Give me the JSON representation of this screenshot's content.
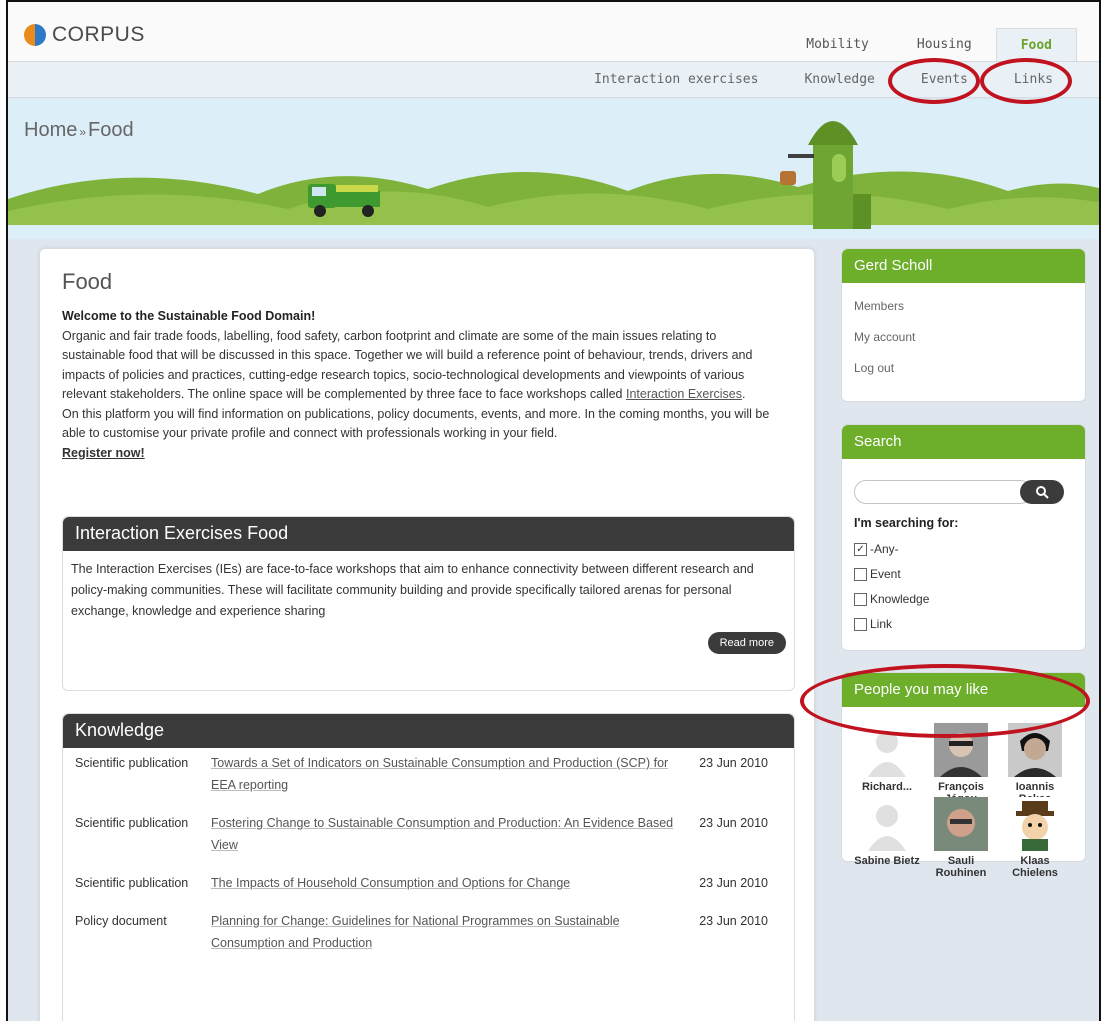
{
  "brand": {
    "name": "CORPUS"
  },
  "main_tabs": [
    {
      "label": "Mobility",
      "active": false
    },
    {
      "label": "Housing",
      "active": false
    },
    {
      "label": "Food",
      "active": true
    }
  ],
  "sub_tabs": [
    {
      "label": "Interaction exercises"
    },
    {
      "label": "Knowledge"
    },
    {
      "label": "Events"
    },
    {
      "label": "Links"
    }
  ],
  "breadcrumb": {
    "home": "Home",
    "sep": "»",
    "current": "Food"
  },
  "page": {
    "title": "Food",
    "welcome": "Welcome to the Sustainable Food Domain!",
    "para1": "Organic and fair trade foods, labelling, food safety, carbon footprint and climate  are some of the main issues relating to sustainable food that will be discussed in this space. Together we will build a reference point of behaviour, trends, drivers and impacts of policies and practices, cutting-edge research topics, socio-technological developments and viewpoints of various relevant stakeholders. The online space will be complemented by three face to face workshops called ",
    "para1_link": "Interaction Exercises",
    "para1_end": ".",
    "para2": "On this platform you will find information on publications, policy documents, events, and more. In the coming months, you will be able to customise your private profile and connect with professionals working in your field.",
    "register": "Register now!"
  },
  "interaction_card": {
    "title": "Interaction Exercises Food",
    "body": "The Interaction Exercises (IEs) are face-to-face workshops that aim to enhance connectivity between different research and policy-making communities. These will facilitate community building and provide specifically tailored arenas for personal exchange, knowledge and experience sharing",
    "read_more": "Read more"
  },
  "knowledge_card": {
    "title": "Knowledge",
    "rows": [
      {
        "type": "Scientific publication",
        "title": "Towards a Set of Indicators on Sustainable Consumption and Production (SCP) for EEA reporting",
        "date": "23 Jun 2010"
      },
      {
        "type": "Scientific publication",
        "title": "Fostering Change to Sustainable Consumption and Production: An Evidence Based View",
        "date": "23 Jun 2010"
      },
      {
        "type": "Scientific publication",
        "title": "The Impacts of Household Consumption and Options for Change",
        "date": "23 Jun 2010"
      },
      {
        "type": "Policy document",
        "title": "Planning for Change: Guidelines for National Programmes on Sustainable Consumption and Production",
        "date": "23 Jun 2010"
      }
    ]
  },
  "user_box": {
    "name": "Gerd Scholl",
    "links": [
      "Members",
      "My account",
      "Log out"
    ]
  },
  "search_box": {
    "title": "Search",
    "query": "",
    "searching_for": "I'm searching for:",
    "options": [
      {
        "label": "-Any-",
        "checked": true
      },
      {
        "label": "Event",
        "checked": false
      },
      {
        "label": "Knowledge",
        "checked": false
      },
      {
        "label": "Link",
        "checked": false
      }
    ]
  },
  "people_box": {
    "title": "People you may like",
    "people": [
      {
        "name": "Richard...",
        "avatar": "placeholder"
      },
      {
        "name": "François Jégou",
        "avatar": "photo"
      },
      {
        "name": "Ioannis Bakas",
        "avatar": "photo"
      },
      {
        "name": "Sabine Bietz",
        "avatar": "placeholder"
      },
      {
        "name": "Sauli Rouhinen",
        "avatar": "photo"
      },
      {
        "name": "Klaas Chielens",
        "avatar": "cartoon"
      }
    ]
  },
  "colors": {
    "accent_green": "#6dae2b",
    "dark_header": "#3b3b3b",
    "annotation_red": "#c1121f",
    "subbar_bg": "#e9f0f6"
  }
}
